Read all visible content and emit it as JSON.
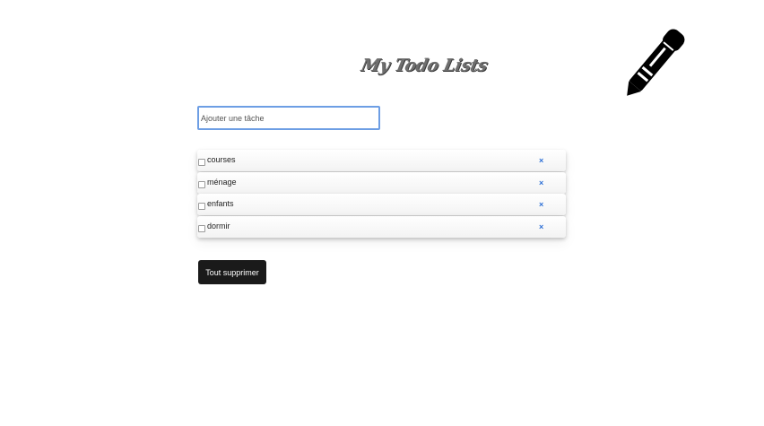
{
  "app": {
    "title": "My Todo Lists"
  },
  "input": {
    "placeholder": "Ajouter une tâche",
    "value": ""
  },
  "todos": [
    {
      "label": "courses",
      "checked": false,
      "delete_label": "×"
    },
    {
      "label": "ménage",
      "checked": false,
      "delete_label": "×"
    },
    {
      "label": "enfants",
      "checked": false,
      "delete_label": "×"
    },
    {
      "label": "dormir",
      "checked": false,
      "delete_label": "×"
    }
  ],
  "actions": {
    "clear_all_label": "Tout supprimer"
  },
  "icons": {
    "decoration": "pen-icon"
  },
  "colors": {
    "input_border": "#6d9ee4",
    "delete_accent": "#2c6fd6",
    "button_bg": "#1a1a1a"
  }
}
